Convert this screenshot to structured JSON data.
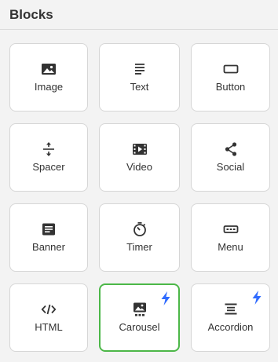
{
  "header": {
    "title": "Blocks"
  },
  "colors": {
    "selected_border": "#4cb748",
    "bolt": "#2f6bff",
    "icon": "#333333"
  },
  "blocks": [
    {
      "label": "Image",
      "icon": "image-icon"
    },
    {
      "label": "Text",
      "icon": "text-icon"
    },
    {
      "label": "Button",
      "icon": "button-icon"
    },
    {
      "label": "Spacer",
      "icon": "spacer-icon"
    },
    {
      "label": "Video",
      "icon": "video-icon"
    },
    {
      "label": "Social",
      "icon": "share-icon"
    },
    {
      "label": "Banner",
      "icon": "banner-icon"
    },
    {
      "label": "Timer",
      "icon": "timer-icon"
    },
    {
      "label": "Menu",
      "icon": "menu-icon"
    },
    {
      "label": "HTML",
      "icon": "code-icon"
    },
    {
      "label": "Carousel",
      "icon": "carousel-icon",
      "selected": true,
      "premium_badge": "bolt-icon"
    },
    {
      "label": "Accordion",
      "icon": "accordion-icon",
      "premium_badge": "bolt-icon"
    }
  ]
}
